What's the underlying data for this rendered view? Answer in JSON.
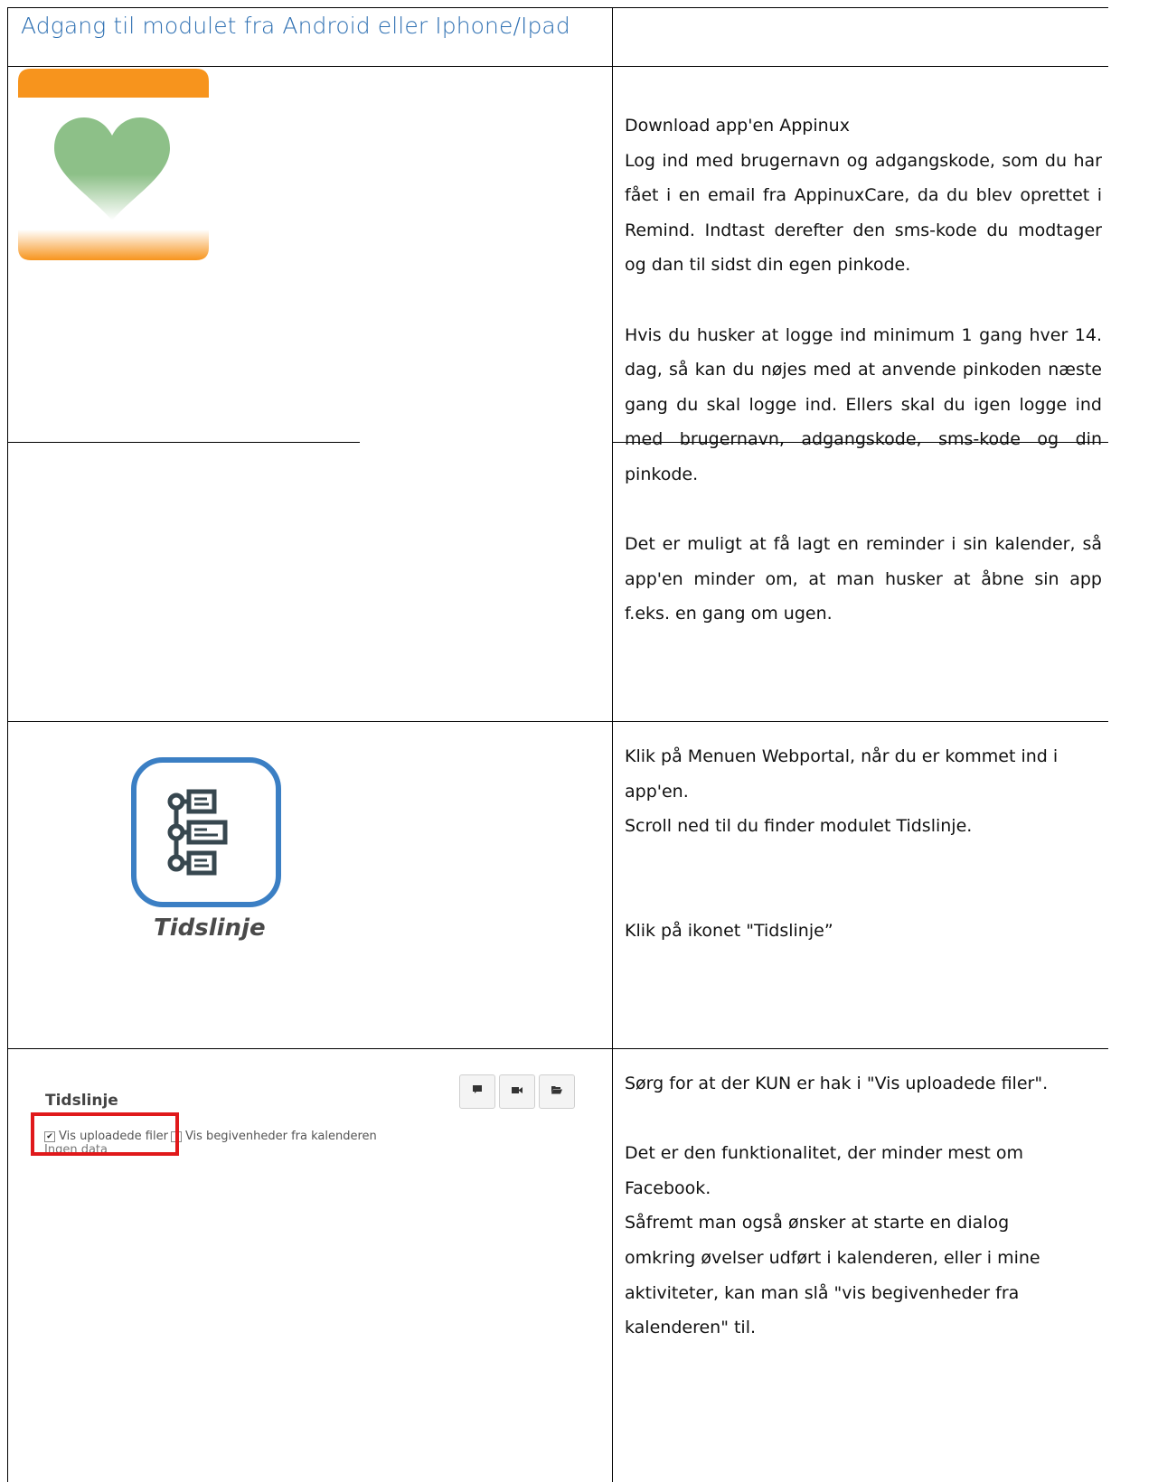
{
  "header": {
    "title": "Adgang til modulet fra Android eller Iphone/Ipad"
  },
  "rows": [
    {
      "paragraphs": [
        [
          "Download app'en Appinux",
          "Log ind med brugernavn og adgangskode, som du har fået i en email fra AppinuxCare, da du blev oprettet i Remind. Indtast derefter den sms-kode du modtager og dan til sidst din egen pinkode."
        ],
        [
          "Hvis du husker at logge ind minimum 1 gang hver 14. dag, så kan du nøjes med at anvende pinkoden næste gang du skal logge ind. Ellers skal du igen logge ind med brugernavn, adgangskode, sms-kode og din pinkode."
        ],
        [
          "Det er muligt at få lagt en reminder i sin kalender, så app'en minder om, at man husker at åbne sin app f.eks. en gang om ugen."
        ]
      ]
    },
    {
      "icon_caption": "Tidslinje",
      "paragraphs": [
        [
          "Klik på Menuen Webportal, når du er kommet ind i app'en.",
          "Scroll ned til du finder modulet Tidslinje."
        ],
        [
          "Klik på ikonet \"Tidslinje”"
        ]
      ]
    },
    {
      "mock": {
        "title": "Tidslinje",
        "checkbox_uploaded": "Vis uploadede filer",
        "checkbox_calendar": "Vis begivenheder fra kalenderen",
        "no_data": "Ingen data",
        "buttons": [
          "comment-icon",
          "video-icon",
          "folder-open-icon"
        ]
      },
      "paragraphs": [
        [
          "Sørg for at der KUN er hak i \"Vis uploadede filer\"."
        ],
        [
          "Det er den funktionalitet, der minder mest om",
          "Facebook.",
          "Såfremt man også ønsker at starte en dialog omkring øvelser udført i kalenderen, eller i mine aktiviteter, kan man slå \"vis begivenheder fra kalenderen\" til."
        ]
      ]
    }
  ],
  "colors": {
    "title": "#2d6fb2",
    "app_icon_orange": "#f7941d",
    "app_icon_heart": "#8dc088",
    "timeline_icon_border": "#3b7fc4",
    "timeline_icon_glyph": "#37474f",
    "highlight": "#e0191b"
  }
}
